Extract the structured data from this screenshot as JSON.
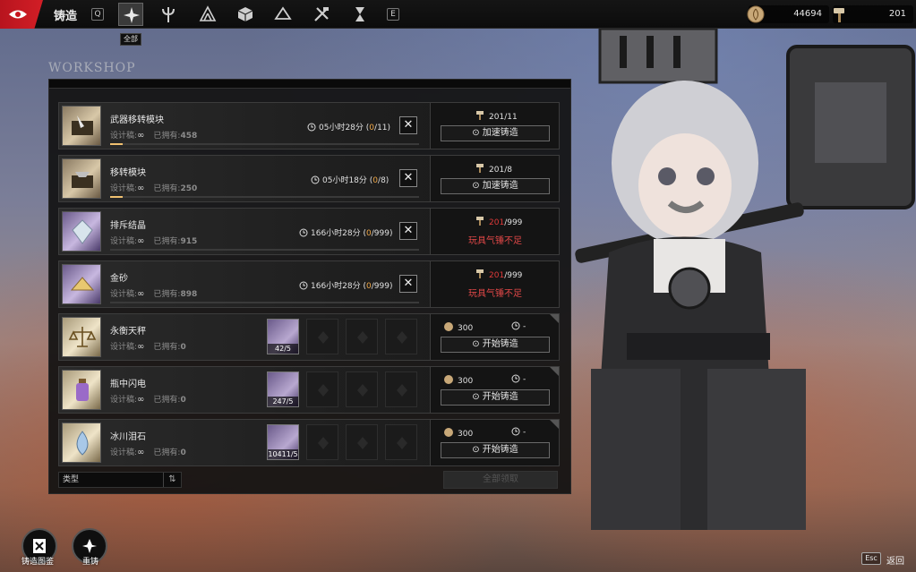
{
  "header": {
    "title": "铸造",
    "key_prev": "Q",
    "key_next": "E",
    "active_category_tooltip": "全部",
    "categories": [
      "all-icon",
      "trident-icon",
      "triforce-icon",
      "cube-icon",
      "hanger-icon",
      "crossed-hammer-icon",
      "hourglass-icon"
    ]
  },
  "currencies": [
    {
      "icon": "coin-icon",
      "value": "44694"
    },
    {
      "icon": "hammer-icon",
      "value": "201"
    }
  ],
  "panel": {
    "deco_text": "WORKSHOP"
  },
  "labels": {
    "blueprint": "设计稿:",
    "owned": "已拥有:",
    "speed_up": "加速铸造",
    "start": "开始铸造",
    "insufficient": "玩具气锤不足"
  },
  "in_progress": [
    {
      "name": "武器移转模块",
      "owned": "458",
      "time": "05小时28分",
      "done": "0",
      "total": "11",
      "hammer_have": "201",
      "hammer_need": "11",
      "enough": true,
      "thumb": "brown"
    },
    {
      "name": "移转模块",
      "owned": "250",
      "time": "05小时18分",
      "done": "0",
      "total": "8",
      "hammer_have": "201",
      "hammer_need": "8",
      "enough": true,
      "thumb": "brown"
    },
    {
      "name": "排斥结晶",
      "owned": "915",
      "time": "166小时28分",
      "done": "0",
      "total": "999",
      "hammer_have": "201",
      "hammer_need": "999",
      "enough": false,
      "thumb": "purple"
    },
    {
      "name": "金砂",
      "owned": "898",
      "time": "166小时28分",
      "done": "0",
      "total": "999",
      "hammer_have": "201",
      "hammer_need": "999",
      "enough": false,
      "thumb": "purple"
    }
  ],
  "recipes": [
    {
      "name": "永衡天秤",
      "owned": "0",
      "material_count": "42/5",
      "cost": "300",
      "duration": "-",
      "thumb": "tan"
    },
    {
      "name": "瓶中闪电",
      "owned": "0",
      "material_count": "247/5",
      "cost": "300",
      "duration": "-",
      "thumb": "tan"
    },
    {
      "name": "冰川泪石",
      "owned": "0",
      "material_count": "10411/5",
      "cost": "300",
      "duration": "-",
      "thumb": "tan"
    }
  ],
  "footer": {
    "filter_label": "类型",
    "claim_all": "全部领取"
  },
  "bottom": {
    "codex_label": "铸造图鉴",
    "recast_label": "重铸",
    "esc_key": "Esc",
    "back_label": "返回"
  },
  "colors": {
    "accent_red": "#d21e26",
    "progress_orange": "#f0a848",
    "warning_red": "#e24848"
  }
}
